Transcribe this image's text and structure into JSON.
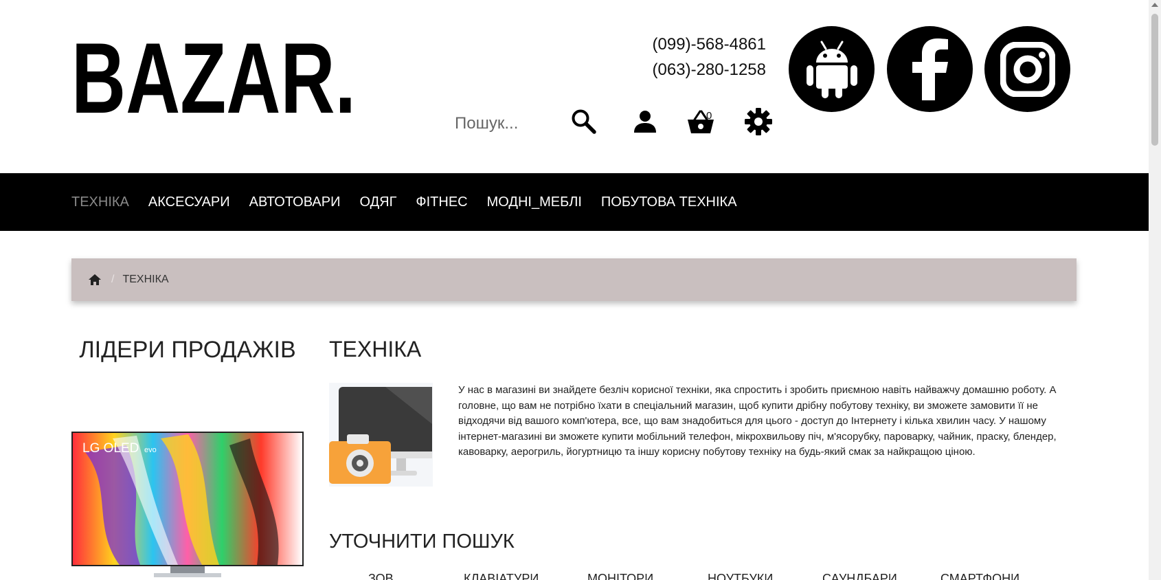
{
  "header": {
    "logo_text": "BAZAR.",
    "phones": [
      "(099)-568-4861",
      "(063)-280-1258"
    ],
    "search_placeholder": "Пошук...",
    "cart_count": "0",
    "social_icons": [
      "android-icon",
      "facebook-icon",
      "instagram-icon"
    ]
  },
  "nav": {
    "items": [
      {
        "label": "ТЕХНІКА",
        "active": true
      },
      {
        "label": "АКСЕСУАРИ"
      },
      {
        "label": "АВТОТОВАРИ"
      },
      {
        "label": "ОДЯГ"
      },
      {
        "label": "ФІТНЕС"
      },
      {
        "label": "МОДНІ_МЕБЛІ"
      },
      {
        "label": "ПОБУТОВА ТЕХНІКА"
      }
    ]
  },
  "breadcrumb": {
    "separator": "/",
    "current": "ТЕХНІКА"
  },
  "sidebar": {
    "title": "ЛІДЕРИ ПРОДАЖІВ",
    "product_brand": "LG OLED",
    "product_brand_sub": "evo"
  },
  "main": {
    "title": "ТЕХНІКА",
    "description": "У нас в магазині ви знайдете безліч корисної техніки, яка спростить і зробить приємною навіть найважчу домашню роботу. А головне, що вам не потрібно їхати в спеціальний магазин, щоб купити дрібну побутову техніку, ви зможете замовити її не відходячи від вашого комп'ютера, все, що вам знадобиться для цього - доступ до Інтернету і кілька хвилин часу. У нашому інтернет-магазині ви зможете купити мобільний телефон, мікрохвильову піч, м'ясорубку, пароварку, чайник, праску, блендер, кавоварку, аерогриль, йогуртницю та іншу корисну побутову техніку на будь-який смак за найкращою ціною.",
    "refine_title": "УТОЧНИТИ ПОШУК",
    "refine_links": [
      "ЗОВ",
      "КЛАВІАТУРИ",
      "МОНІТОРИ",
      "НОУТБУКИ",
      "САУНДБАРИ",
      "СМАРТФОНИ"
    ]
  },
  "colors": {
    "nav_bg": "#000000",
    "nav_active": "#8a8a8a",
    "breadcrumb_bg": "#c9bfbf"
  }
}
